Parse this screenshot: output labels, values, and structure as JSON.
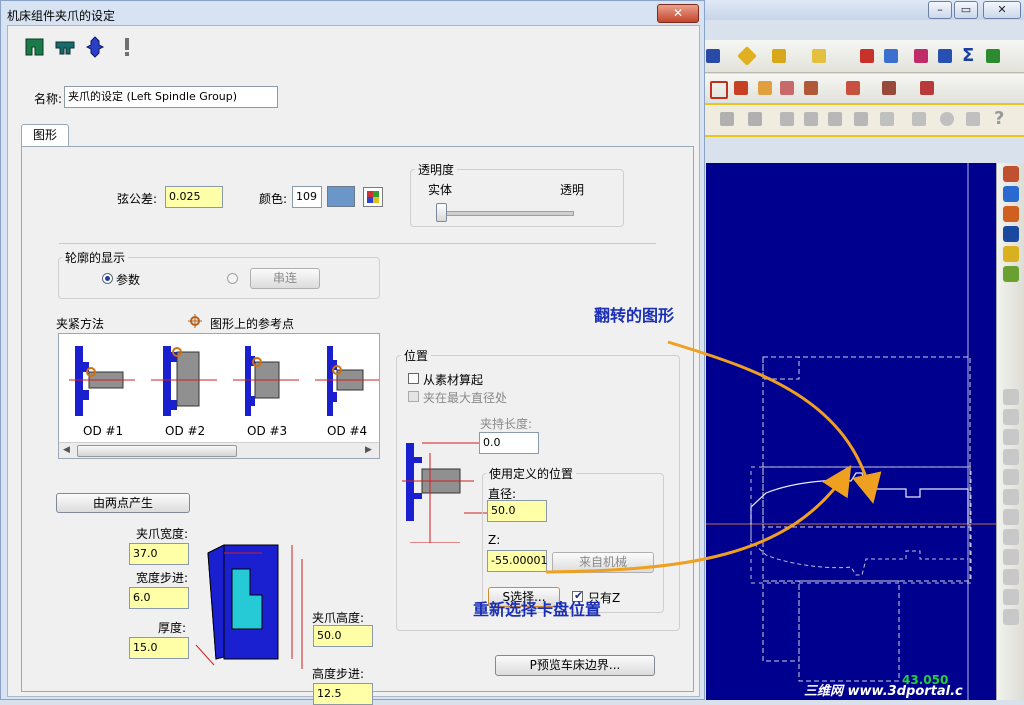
{
  "dialog": {
    "title": "机床组件夹爪的设定",
    "close_icon": "close-icon",
    "toolbar_icons": [
      "jaw-green-icon",
      "jaw-group-icon",
      "jaw-blue-icon",
      "exclamation-icon"
    ],
    "name_label": "名称:",
    "name_value": "夹爪的设定 (Left Spindle Group)",
    "tab_label": "图形",
    "chord_tol_label": "弦公差:",
    "chord_tol_value": "0.025",
    "color_label": "颜色:",
    "color_value": "109",
    "color_swatch": "#6b96c8",
    "transparency": {
      "group_label": "透明度",
      "solid_label": "实体",
      "transparent_label": "透明",
      "level": 0
    },
    "outline_display": {
      "group_label": "轮廓的显示",
      "param_label": "参数",
      "series_label": "串连",
      "selected": "参数"
    },
    "clamp_method_label": "夹紧方法",
    "ref_point_label": "图形上的参考点",
    "jaws": [
      {
        "label": "OD #1"
      },
      {
        "label": "OD #2"
      },
      {
        "label": "OD #3"
      },
      {
        "label": "OD #4"
      }
    ],
    "from_two_points_button": "由两点产生",
    "jaw_width_label": "夹爪宽度:",
    "jaw_width_value": "37.0",
    "width_step_label": "宽度步进:",
    "width_step_value": "6.0",
    "thickness_label": "厚度:",
    "thickness_value": "15.0",
    "jaw_height_label": "夹爪高度:",
    "jaw_height_value": "50.0",
    "height_step_label": "高度步进:",
    "height_step_value": "12.5",
    "position": {
      "group_label": "位置",
      "from_stock_label": "从素材算起",
      "from_stock_checked": false,
      "max_diameter_label": "夹在最大直径处",
      "clamp_length_label": "夹持长度:",
      "clamp_length_value": "0.0",
      "user_defined_label": "使用定义的位置",
      "diameter_label": "直径:",
      "diameter_value": "50.0",
      "z_label": "Z:",
      "z_value": "-55.00001",
      "from_machine_button": "来自机械",
      "select_button": "S选择...",
      "only_label": "只有Z",
      "only_checked": true
    },
    "preview_button": "P预览车床边界..."
  },
  "annotations": {
    "flipped_shape": "翻转的图形",
    "reselect_chuck": "重新选择卡盘位置"
  },
  "background_app": {
    "status_value": "43.050",
    "watermark": "三维网 www.3dportal.c"
  }
}
